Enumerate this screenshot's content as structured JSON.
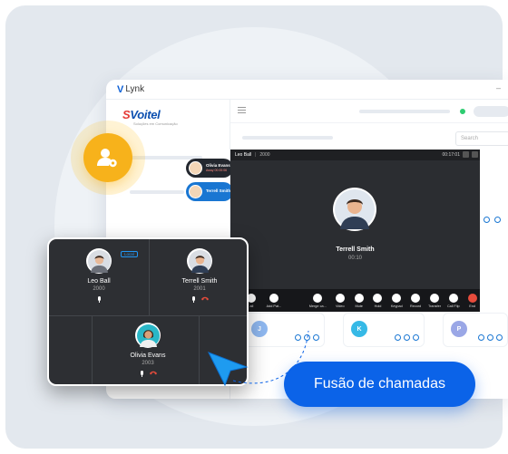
{
  "app": {
    "title": "Lynk",
    "logo_letter": "V",
    "minimize_symbol": "–",
    "brand": {
      "name_prefix": "S",
      "name_rest": "Voitel",
      "tagline": "Soluções em Comunicação"
    },
    "search_placeholder": "Search"
  },
  "incoming_pills": [
    {
      "name": "Olivia Evans",
      "subtitle": "Away 00:00:06"
    },
    {
      "name": "Terrell Smith",
      "subtitle": ""
    }
  ],
  "call_window": {
    "caller": "Leo Ball",
    "separator": "|",
    "extension": "2000",
    "top_timer": "00:17:01",
    "contact_name": "Terrell Smith",
    "duration": "00:10",
    "controls": [
      {
        "label": "all",
        "icon": "transfer-icon"
      },
      {
        "label": "Add Pat...",
        "icon": "add-participant-icon"
      },
      {
        "label": "Merge ca...",
        "icon": "merge-call-icon"
      },
      {
        "label": "Video",
        "icon": "video-icon"
      },
      {
        "label": "Mute",
        "icon": "mic-icon"
      },
      {
        "label": "Hold",
        "icon": "pause-icon"
      },
      {
        "label": "Keypad",
        "icon": "keypad-icon"
      },
      {
        "label": "Record",
        "icon": "record-icon"
      },
      {
        "label": "Transfer",
        "icon": "transfer-icon"
      },
      {
        "label": "Call Flip",
        "icon": "call-flip-icon"
      },
      {
        "label": "End",
        "icon": "end-call-icon"
      }
    ]
  },
  "contact_cards": [
    {
      "initial": "J",
      "color": "#8fb8f0"
    },
    {
      "initial": "K",
      "color": "#36b9e6"
    },
    {
      "initial": "P",
      "color": "#9aa7e6"
    }
  ],
  "conference": {
    "local_tag": "Local",
    "participants": [
      {
        "name": "Leo Ball",
        "ext": "2000"
      },
      {
        "name": "Terrell Smith",
        "ext": "2001"
      },
      {
        "name": "Olivia Evans",
        "ext": "2003"
      }
    ]
  },
  "callout": {
    "label": "Fusão de chamadas"
  },
  "colors": {
    "accent": "#0b63e8",
    "badge": "#f7b21b",
    "end": "#e74c3c"
  }
}
